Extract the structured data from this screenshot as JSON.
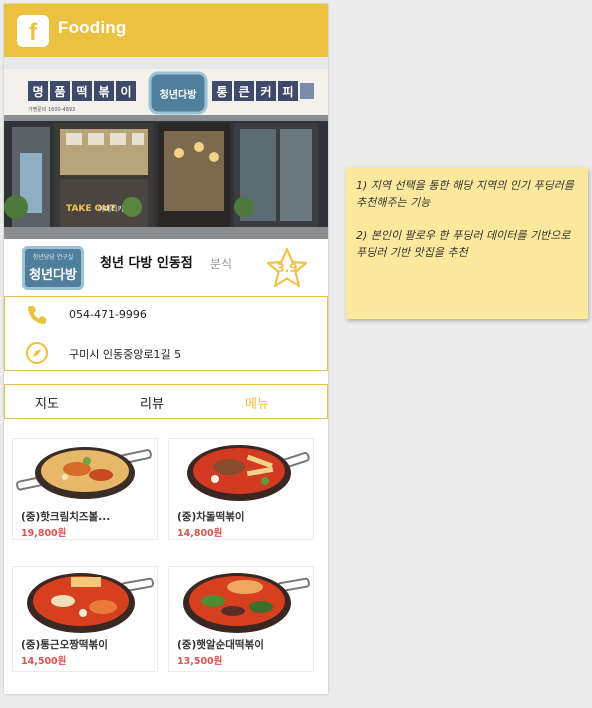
{
  "app": {
    "logo_letter": "f",
    "title": "Fooding",
    "brand_color": "#eac23f"
  },
  "hero": {
    "sign_left": [
      "명",
      "품",
      "떡",
      "볶",
      "이"
    ],
    "sign_center": "청년다방",
    "sign_right": [
      "통",
      "큰",
      "커",
      "피"
    ],
    "sign_small": "가맹문의 1600-4893",
    "window_text_left": "TAKE OUT",
    "window_text_mid": "아메리카노"
  },
  "restaurant": {
    "logo_small": "청년당당 연구실",
    "logo_text": "청년다방",
    "name": "청년 다방 인동점",
    "category": "분식",
    "rating": "3.9",
    "rating_color": "#f0c348"
  },
  "contact": {
    "phone": "054-471-9996",
    "address": "구미시 인동중앙로1길 5"
  },
  "tabs": [
    {
      "label": "지도",
      "active": false
    },
    {
      "label": "리뷰",
      "active": false
    },
    {
      "label": "메뉴",
      "active": true
    }
  ],
  "menu": [
    {
      "name": "(중)핫크림치즈볼...",
      "price": "19,800원"
    },
    {
      "name": "(중)차돌떡볶이",
      "price": "14,800원"
    },
    {
      "name": "(중)통근오짱떡볶이",
      "price": "14,500원"
    },
    {
      "name": "(중)햇알순대떡볶이",
      "price": "13,500원"
    }
  ],
  "note": {
    "line1": "1) 지역 선택을 통한 해당 지역의 인기 푸딩러를 추천해주는 기능",
    "line2": "2) 본인이 팔로우 한 푸딩러 데이터를 기반으로 푸딩러 기반 맛집을 추천"
  }
}
